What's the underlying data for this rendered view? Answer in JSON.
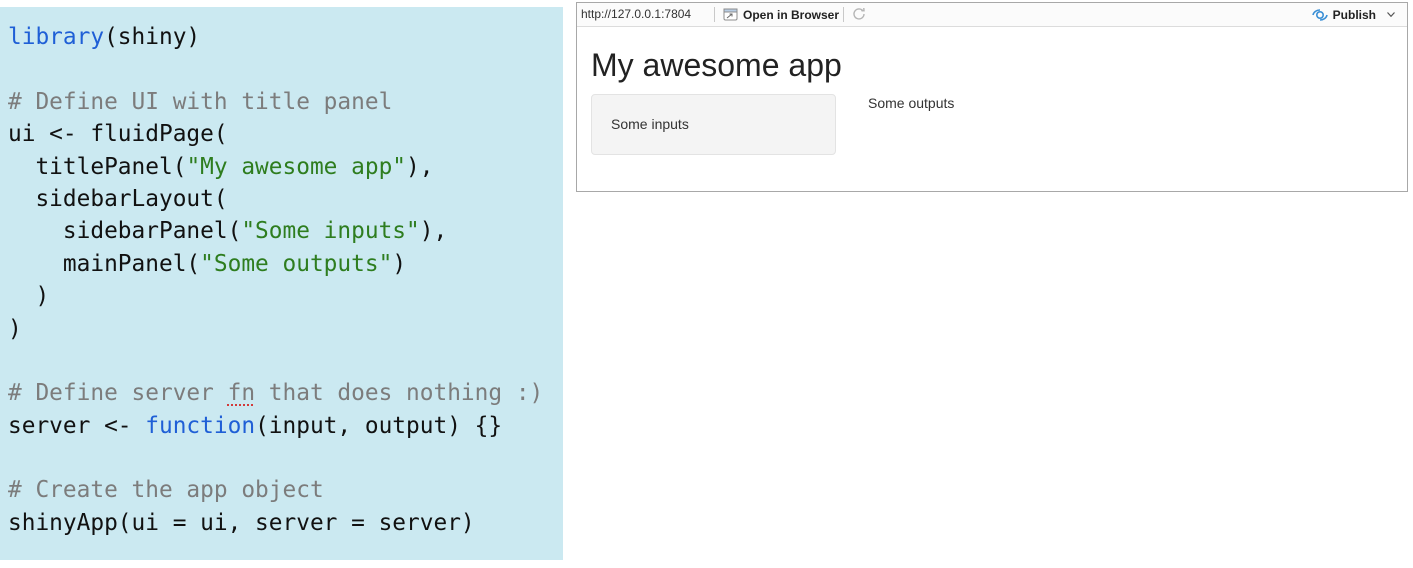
{
  "editor": {
    "lines": [
      [
        {
          "t": "library",
          "k": "keyword"
        },
        {
          "t": "(shiny)",
          "k": "plain"
        }
      ],
      [],
      [
        {
          "t": "# Define UI with title panel",
          "k": "comment"
        }
      ],
      [
        {
          "t": "ui <- fluidPage(",
          "k": "plain"
        }
      ],
      [
        {
          "t": "  titlePanel(",
          "k": "plain"
        },
        {
          "t": "\"My awesome app\"",
          "k": "string"
        },
        {
          "t": "),",
          "k": "plain"
        }
      ],
      [
        {
          "t": "  sidebarLayout(",
          "k": "plain"
        }
      ],
      [
        {
          "t": "    sidebarPanel(",
          "k": "plain"
        },
        {
          "t": "\"Some inputs\"",
          "k": "string"
        },
        {
          "t": "),",
          "k": "plain"
        }
      ],
      [
        {
          "t": "    mainPanel(",
          "k": "plain"
        },
        {
          "t": "\"Some outputs\"",
          "k": "string"
        },
        {
          "t": ")",
          "k": "plain"
        }
      ],
      [
        {
          "t": "  )",
          "k": "plain"
        }
      ],
      [
        {
          "t": ")",
          "k": "plain"
        }
      ],
      [],
      [
        {
          "t": "# Define server ",
          "k": "comment"
        },
        {
          "t": "fn",
          "k": "comment",
          "flag": true
        },
        {
          "t": " that does nothing :)",
          "k": "comment"
        }
      ],
      [
        {
          "t": "server <- ",
          "k": "plain"
        },
        {
          "t": "function",
          "k": "keyword"
        },
        {
          "t": "(input, output) {}",
          "k": "plain"
        }
      ],
      [],
      [
        {
          "t": "# Create the app object",
          "k": "comment"
        }
      ],
      [
        {
          "t": "shinyApp(ui = ui, server = server)",
          "k": "plain"
        }
      ]
    ],
    "colors": {
      "background": "#cbe9f1",
      "plain": "#111111",
      "keyword": "#1f5fd6",
      "string": "#2e7d1f",
      "comment": "#7c7c7c",
      "spellcheck_underline": "#d23a3a"
    }
  },
  "viewer": {
    "url": "http://127.0.0.1:7804",
    "open_in_browser_label": "Open in Browser",
    "publish_label": "Publish",
    "icons": {
      "open_in_browser": "browser-window-icon",
      "refresh": "refresh-icon",
      "publish": "publish-icon",
      "menu": "chevron-down-icon"
    },
    "colors": {
      "publish_icon": "#3a8fd6"
    },
    "app": {
      "title": "My awesome app",
      "sidebar_text": "Some inputs",
      "main_text": "Some outputs"
    }
  }
}
